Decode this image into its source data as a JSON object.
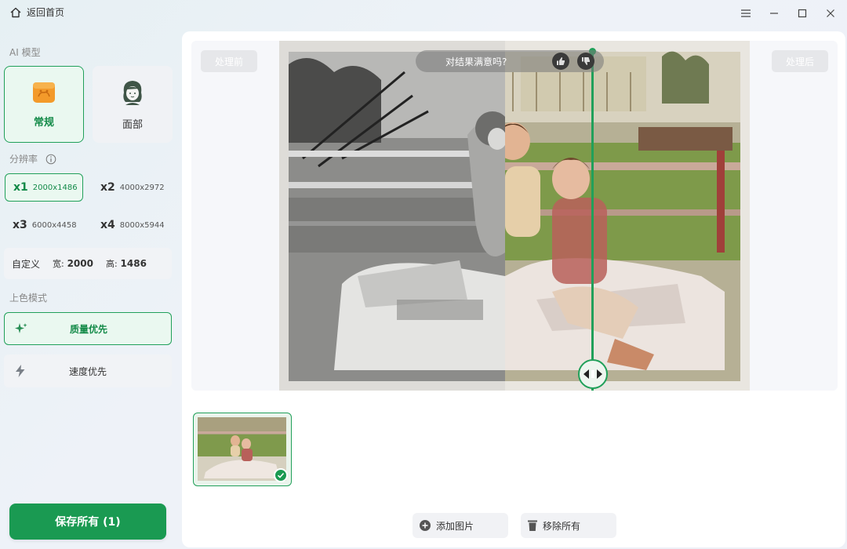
{
  "titlebar": {
    "back_label": "返回首页",
    "icons": [
      "home-icon",
      "menu-icon",
      "minimize-icon",
      "maximize-icon",
      "close-icon"
    ]
  },
  "sidebar": {
    "ai_model_label": "AI 模型",
    "models": [
      {
        "label": "常规",
        "icon": "portrait-icon",
        "selected": true
      },
      {
        "label": "面部",
        "icon": "face-icon",
        "selected": false
      }
    ],
    "resolution_label": "分辨率",
    "resolutions": [
      {
        "mult": "x1",
        "size": "2000x1486",
        "selected": true
      },
      {
        "mult": "x2",
        "size": "4000x2972",
        "selected": false
      },
      {
        "mult": "x3",
        "size": "6000x4458",
        "selected": false
      },
      {
        "mult": "x4",
        "size": "8000x5944",
        "selected": false
      }
    ],
    "custom": {
      "label": "自定义",
      "width_label": "宽:",
      "width_value": "2000",
      "height_label": "高:",
      "height_value": "1486"
    },
    "color_mode_label": "上色模式",
    "color_modes": [
      {
        "label": "质量优先",
        "icon": "sparkle-icon",
        "selected": true
      },
      {
        "label": "速度优先",
        "icon": "lightning-icon",
        "selected": false
      }
    ],
    "save_label": "保存所有 (1)"
  },
  "preview": {
    "before_label": "处理前",
    "after_label": "处理后",
    "feedback_text": "对结果满意吗?",
    "split_fraction": 0.48
  },
  "thumbnails": [
    {
      "selected": true
    }
  ],
  "actions": {
    "add_label": "添加图片",
    "remove_label": "移除所有"
  },
  "colors": {
    "accent": "#1a9a52",
    "accent_light": "#eaf8f0"
  }
}
